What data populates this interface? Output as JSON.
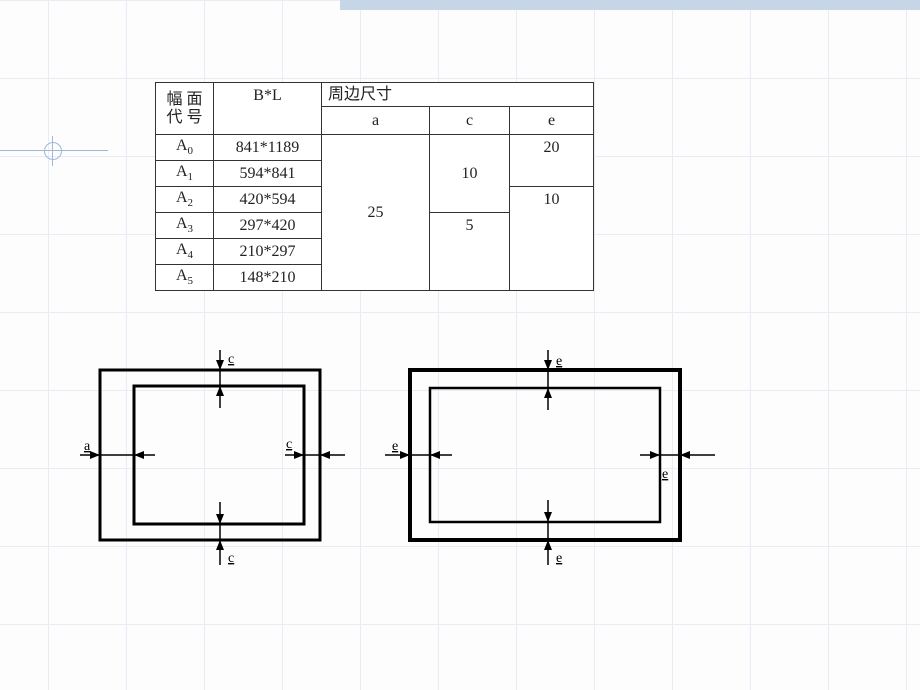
{
  "table": {
    "header": {
      "code": "幅 面\n代 号",
      "bl": "B*L",
      "border_label": "周边尺寸",
      "a": "a",
      "c": "c",
      "e": "e"
    },
    "rows": {
      "a0": {
        "code_base": "A",
        "code_sub": "0",
        "bl": "841*1189"
      },
      "a1": {
        "code_base": "A",
        "code_sub": "1",
        "bl": "594*841"
      },
      "a2": {
        "code_base": "A",
        "code_sub": "2",
        "bl": "420*594"
      },
      "a3": {
        "code_base": "A",
        "code_sub": "3",
        "bl": "297*420"
      },
      "a4": {
        "code_base": "A",
        "code_sub": "4",
        "bl": "210*297"
      },
      "a5": {
        "code_base": "A",
        "code_sub": "5",
        "bl": "148*210"
      }
    },
    "values": {
      "a_all": "25",
      "c_0_2": "10",
      "c_3_5": "5",
      "e_0_1": "20",
      "e_2_5": "10"
    }
  },
  "diagram": {
    "labels": {
      "a": "a",
      "c": "c",
      "e": "e"
    }
  }
}
